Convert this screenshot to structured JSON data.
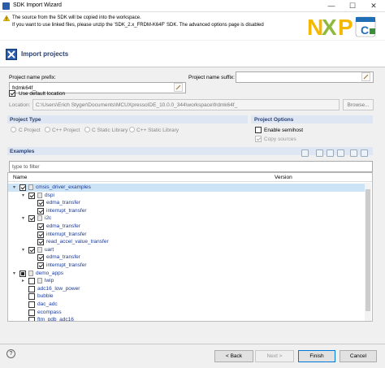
{
  "window": {
    "title": "SDK Import Wizard",
    "minimize": "—",
    "maximize": "☐",
    "close": "✕"
  },
  "header": {
    "line1": "The source from the SDK will be copied into the workspace.",
    "line2": "If you want to use linked files, please unzip the 'SDK_2.x_FRDM-K64F' SDK. The advanced options page is disabled",
    "logo_text": "NXP"
  },
  "banner": {
    "title": "Import projects"
  },
  "form": {
    "prefix_label": "Project name prefix:",
    "prefix_value": "frdmk64f_",
    "suffix_label": "Project name suffix:",
    "suffix_value": "",
    "default_location_label": "Use default location",
    "default_location_checked": true,
    "location_label": "Location:",
    "location_value": "C:\\Users\\Erich Styger\\Documents\\MCUXpressoIDE_10.0.0_344\\workspace\\frdmk64f_",
    "browse_label": "Browse..."
  },
  "project_type": {
    "title": "Project Type",
    "options": [
      "C Project",
      "C++ Project",
      "C Static Library",
      "C++ Static Library"
    ]
  },
  "project_options": {
    "title": "Project Options",
    "semihost_label": "Enable semihost",
    "copy_sources_label": "Copy sources"
  },
  "examples": {
    "title": "Examples",
    "filter_placeholder": "type to filter",
    "col_name": "Name",
    "col_version": "Version",
    "rows": [
      {
        "label": "cmsis_driver_examples",
        "level": 0,
        "expand": "▾",
        "state": "on",
        "folder": true
      },
      {
        "label": "dspi",
        "level": 1,
        "expand": "▾",
        "state": "on",
        "folder": true
      },
      {
        "label": "edma_transfer",
        "level": 2,
        "expand": "",
        "state": "on",
        "folder": false
      },
      {
        "label": "interrupt_transfer",
        "level": 2,
        "expand": "",
        "state": "on",
        "folder": false
      },
      {
        "label": "i2c",
        "level": 1,
        "expand": "▾",
        "state": "on",
        "folder": true
      },
      {
        "label": "edma_transfer",
        "level": 2,
        "expand": "",
        "state": "on",
        "folder": false
      },
      {
        "label": "interrupt_transfer",
        "level": 2,
        "expand": "",
        "state": "on",
        "folder": false
      },
      {
        "label": "read_accel_value_transfer",
        "level": 2,
        "expand": "",
        "state": "on",
        "folder": false
      },
      {
        "label": "uart",
        "level": 1,
        "expand": "▾",
        "state": "on",
        "folder": true
      },
      {
        "label": "edma_transfer",
        "level": 2,
        "expand": "",
        "state": "on",
        "folder": false
      },
      {
        "label": "interrupt_transfer",
        "level": 2,
        "expand": "",
        "state": "on",
        "folder": false
      },
      {
        "label": "demo_apps",
        "level": 0,
        "expand": "▾",
        "state": "partial",
        "folder": true
      },
      {
        "label": "lwip",
        "level": 1,
        "expand": "▸",
        "state": "off",
        "folder": true
      },
      {
        "label": "adc16_low_power",
        "level": 1,
        "expand": "",
        "state": "off",
        "folder": false
      },
      {
        "label": "bubble",
        "level": 1,
        "expand": "",
        "state": "off",
        "folder": false
      },
      {
        "label": "dac_adc",
        "level": 1,
        "expand": "",
        "state": "off",
        "folder": false
      },
      {
        "label": "ecompass",
        "level": 1,
        "expand": "",
        "state": "off",
        "folder": false
      },
      {
        "label": "ftm_pdb_adc16",
        "level": 1,
        "expand": "",
        "state": "off",
        "folder": false
      }
    ]
  },
  "buttons": {
    "help": "?",
    "back": "< Back",
    "next": "Next >",
    "finish": "Finish",
    "cancel": "Cancel"
  },
  "colors": {
    "accent": "#2a5caa",
    "selection": "#cde4f7",
    "link": "#1a3a9a"
  }
}
